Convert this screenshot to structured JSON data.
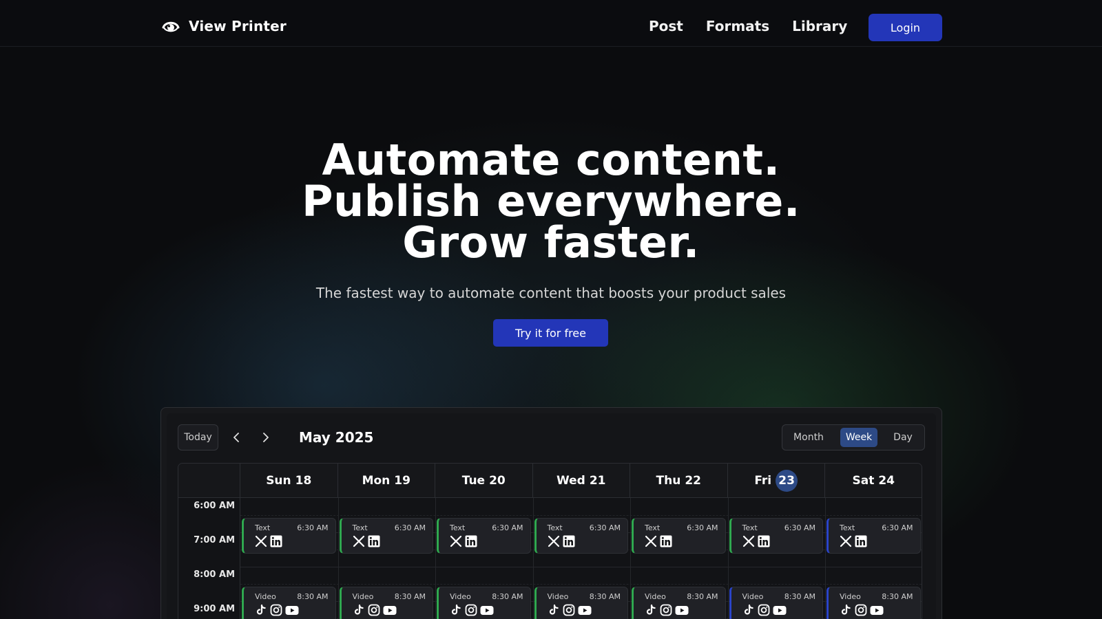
{
  "nav": {
    "brand": "View Printer",
    "links": [
      "Post",
      "Formats",
      "Library"
    ],
    "login": "Login"
  },
  "hero": {
    "line1": "Automate content.",
    "line2": "Publish everywhere.",
    "line3": "Grow faster.",
    "subtitle": "The fastest way to automate content that boosts your product sales",
    "cta": "Try it for free"
  },
  "calendar": {
    "today_label": "Today",
    "month_title": "May 2025",
    "views": [
      "Month",
      "Week",
      "Day"
    ],
    "active_view": "Week",
    "days": [
      {
        "name": "Sun",
        "num": "18"
      },
      {
        "name": "Mon",
        "num": "19"
      },
      {
        "name": "Tue",
        "num": "20"
      },
      {
        "name": "Wed",
        "num": "21"
      },
      {
        "name": "Thu",
        "num": "22"
      },
      {
        "name": "Fri",
        "num": "23"
      },
      {
        "name": "Sat",
        "num": "24"
      }
    ],
    "current_day": "23",
    "times": [
      "6:00 AM",
      "7:00 AM",
      "8:00 AM",
      "9:00 AM"
    ],
    "text_event": {
      "type": "Text",
      "time": "6:30 AM",
      "icons": [
        "x-icon",
        "linkedin-icon"
      ]
    },
    "video_event": {
      "type": "Video",
      "time": "8:30 AM",
      "icons": [
        "tiktok-icon",
        "instagram-icon",
        "youtube-icon"
      ]
    },
    "colors": {
      "green": "#2fa84f",
      "blue": "#2a44c9"
    }
  }
}
